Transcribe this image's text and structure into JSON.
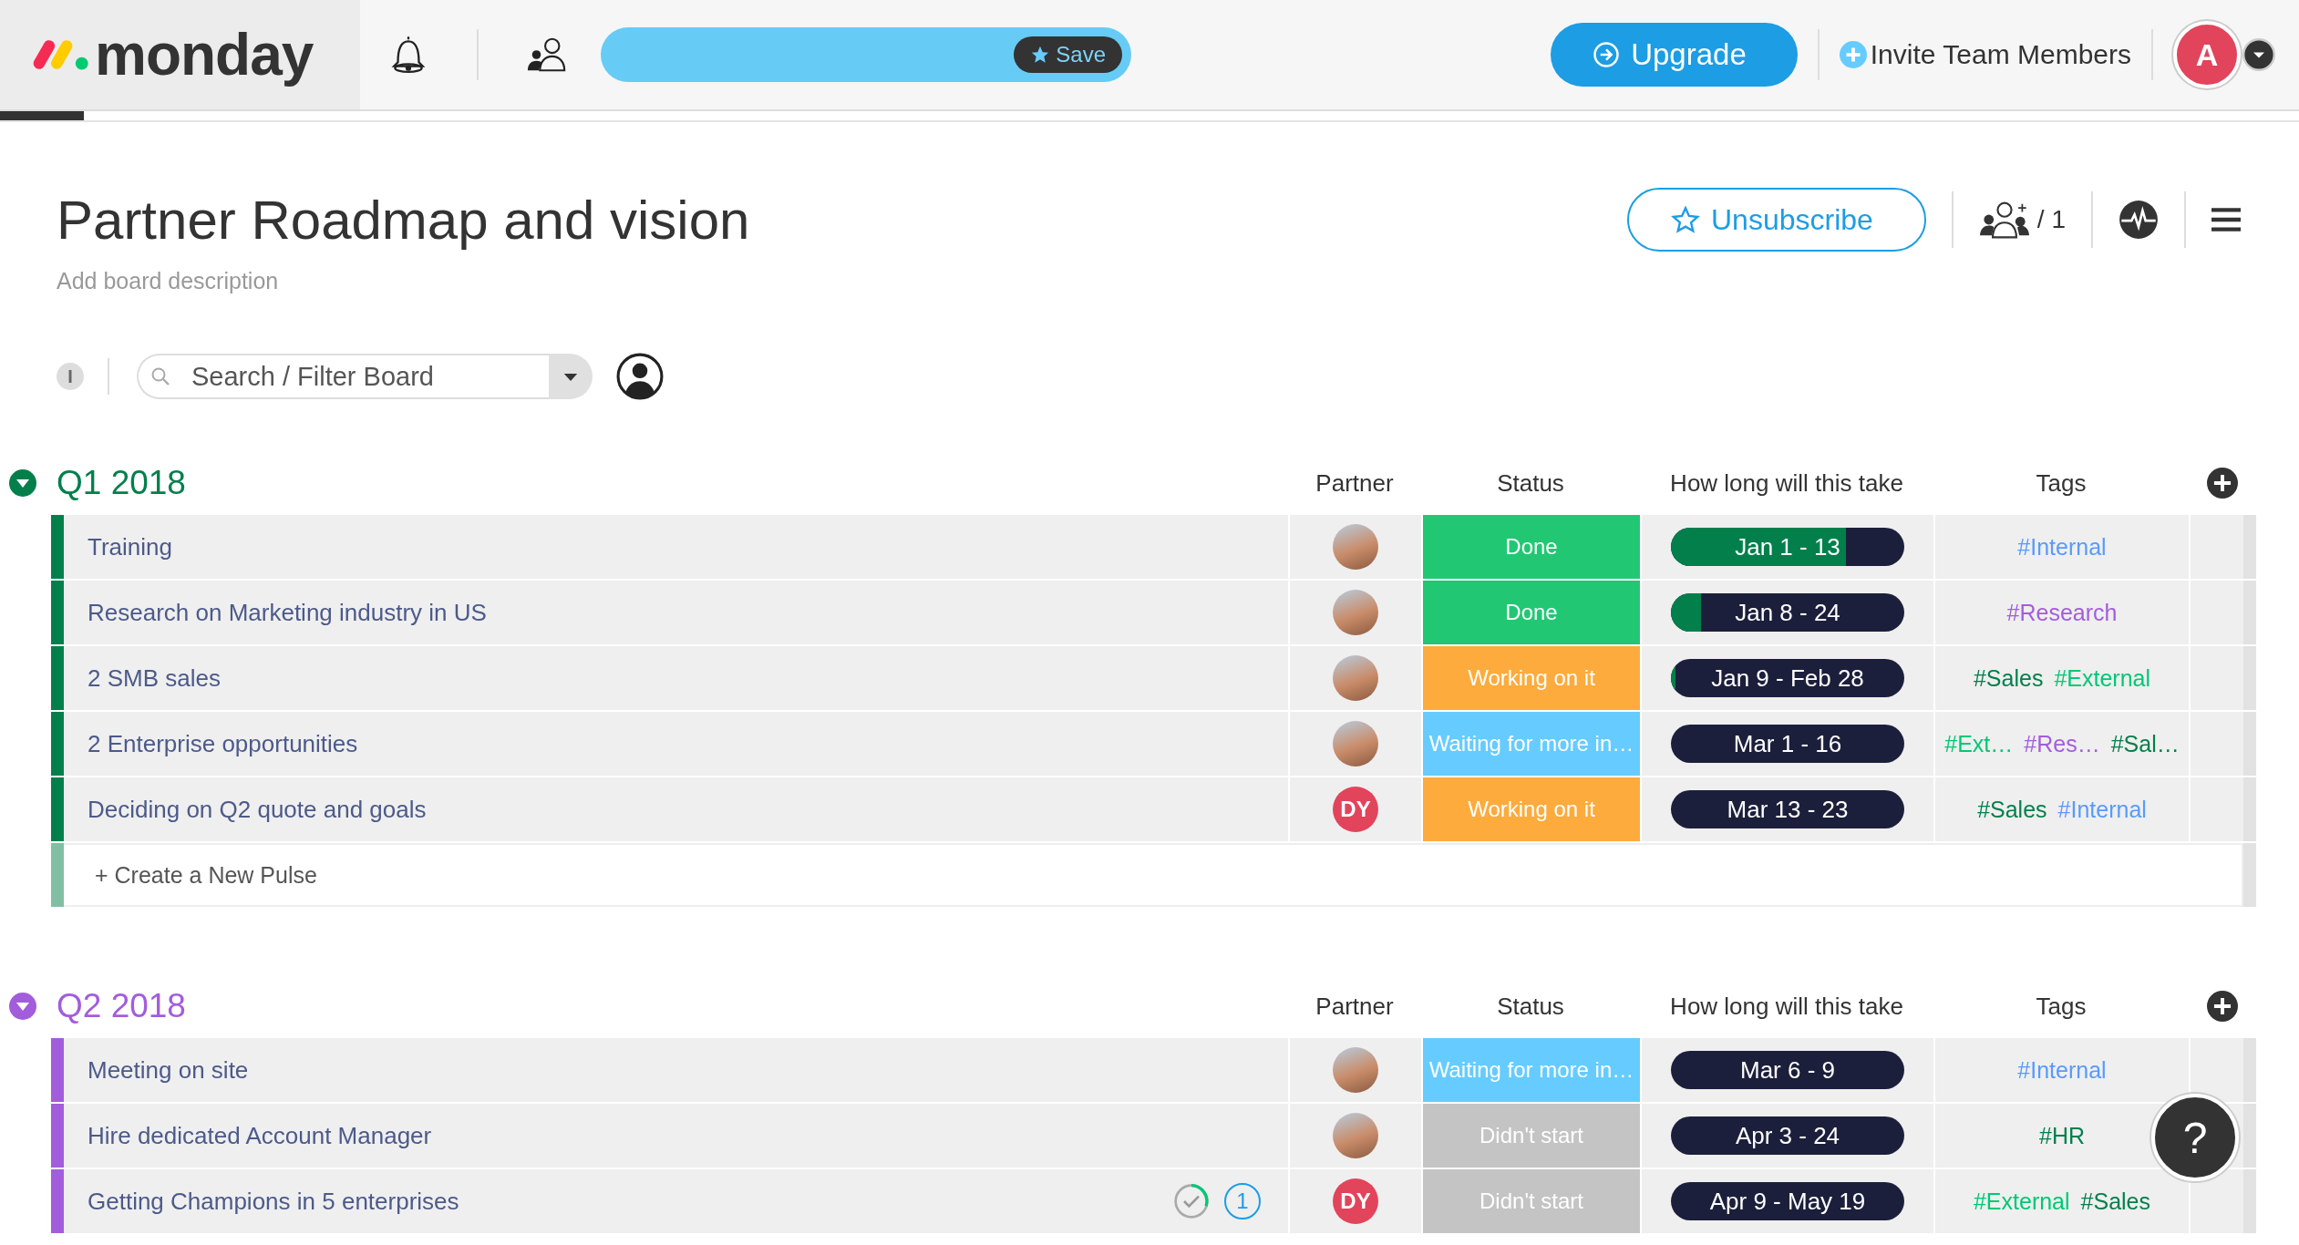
{
  "topbar": {
    "logo": "monday",
    "save_button": "Save",
    "upgrade_button": "Upgrade",
    "invite_link": "Invite Team Members",
    "avatar_initial": "A"
  },
  "board": {
    "title": "Partner Roadmap and vision",
    "description": "Add board description",
    "unsubscribe_button": "Unsubscribe",
    "members_count": "/ 1",
    "info_badge": "I",
    "search": {
      "placeholder": "Search / Filter Board"
    }
  },
  "groups": [
    {
      "title": "Q1 2018",
      "color": "#037f4c",
      "expanded": true,
      "columns": [
        "Partner",
        "Status",
        "How long will this take",
        "Tags"
      ],
      "rows": [
        {
          "name": "Training",
          "partner": {
            "kind": "photo"
          },
          "status": {
            "label": "Done",
            "color": "#22c773"
          },
          "timeline": {
            "label": "Jan 1 - 13",
            "level": 0.75
          },
          "tags": [
            {
              "label": "#Internal",
              "color": "#579bfc"
            }
          ]
        },
        {
          "name": "Research on Marketing industry in US",
          "partner": {
            "kind": "photo"
          },
          "status": {
            "label": "Done",
            "color": "#22c773"
          },
          "timeline": {
            "label": "Jan 8 - 24",
            "level": 0.13
          },
          "tags": [
            {
              "label": "#Research",
              "color": "#a25ddc"
            }
          ]
        },
        {
          "name": "2 SMB sales",
          "partner": {
            "kind": "photo"
          },
          "status": {
            "label": "Working on it",
            "color": "#fdab3d"
          },
          "timeline": {
            "label": "Jan 9 - Feb 28",
            "level": 0.02
          },
          "tags": [
            {
              "label": "#Sales",
              "color": "#037f4c"
            },
            {
              "label": "#External",
              "color": "#00c875"
            }
          ]
        },
        {
          "name": "2 Enterprise opportunities",
          "partner": {
            "kind": "photo"
          },
          "status": {
            "label": "Waiting for more in…",
            "color": "#66ccff"
          },
          "timeline": {
            "label": "Mar 1 - 16"
          },
          "tags": [
            {
              "label": "#Ext…",
              "color": "#00c875"
            },
            {
              "label": "#Res…",
              "color": "#a25ddc"
            },
            {
              "label": "#Sal…",
              "color": "#037f4c"
            }
          ]
        },
        {
          "name": "Deciding on Q2 quote and goals",
          "partner": {
            "kind": "initials",
            "initials": "DY",
            "color": "#e2445c"
          },
          "status": {
            "label": "Working on it",
            "color": "#fdab3d"
          },
          "timeline": {
            "label": "Mar 13 - 23"
          },
          "tags": [
            {
              "label": "#Sales",
              "color": "#037f4c"
            },
            {
              "label": "#Internal",
              "color": "#579bfc"
            }
          ]
        }
      ],
      "new_row": "+ Create a New Pulse"
    },
    {
      "title": "Q2 2018",
      "color": "#a25ddc",
      "expanded": true,
      "columns": [
        "Partner",
        "Status",
        "How long will this take",
        "Tags"
      ],
      "rows": [
        {
          "name": "Meeting on site",
          "partner": {
            "kind": "photo"
          },
          "status": {
            "label": "Waiting for more in…",
            "color": "#66ccff"
          },
          "timeline": {
            "label": "Mar 6 - 9"
          },
          "tags": [
            {
              "label": "#Internal",
              "color": "#579bfc"
            }
          ]
        },
        {
          "name": "Hire dedicated Account Manager",
          "partner": {
            "kind": "photo"
          },
          "status": {
            "label": "Didn't start",
            "color": "#c4c4c4"
          },
          "timeline": {
            "label": "Apr 3 - 24"
          },
          "tags": [
            {
              "label": "#HR",
              "color": "#037f4c"
            }
          ]
        },
        {
          "name": "Getting Champions in 5 enterprises",
          "updates": "1",
          "partner": {
            "kind": "initials",
            "initials": "DY",
            "color": "#e2445c"
          },
          "status": {
            "label": "Didn't start",
            "color": "#c4c4c4"
          },
          "timeline": {
            "label": "Apr 9 - May 19"
          },
          "tags": [
            {
              "label": "#External",
              "color": "#00c875"
            },
            {
              "label": "#Sales",
              "color": "#037f4c"
            }
          ]
        }
      ]
    }
  ],
  "help_button": "?"
}
